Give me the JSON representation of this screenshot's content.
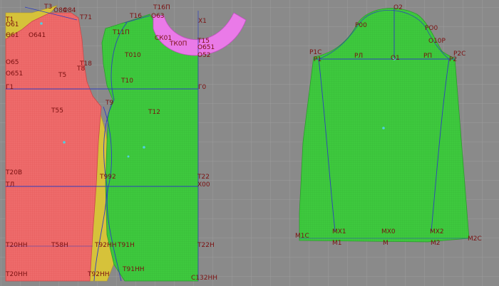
{
  "colors": {
    "background": "#8a8a8a",
    "grid": "#9c9c9c",
    "back_piece": "#ee6b6b",
    "front_piece": "#3ec93e",
    "sleeve_piece": "#3ec93e",
    "yellow_piece": "#d6c23a",
    "facing_piece": "#ea7ae8",
    "line": "#2e3fbf",
    "label": "#7a1010",
    "point": "#4fd0e0"
  },
  "bodice_labels": {
    "t1": "T1",
    "t3": "T3",
    "o84": "О84",
    "o84b": "О84",
    "t71": "Т71",
    "t16": "Т16",
    "t16p": "Т16П",
    "x1": "Х1",
    "o61": "О61",
    "o61b": "Ө61",
    "o641": "О641",
    "t11p": "Т11П",
    "o63": "О63",
    "ck01": "СК01",
    "tkop": "ТК0П",
    "t15": "Т15",
    "o651": "О651",
    "o52": "О52",
    "t18": "Т18",
    "t8": "Т8",
    "o65": "О65",
    "t010": "Т010",
    "o651b": "О651",
    "t5": "Т5",
    "t10": "Т10",
    "g1": "Г1",
    "g0": "Г0",
    "t9": "Т9",
    "t55": "Т55",
    "t12": "Т12",
    "t20b": "Т20В",
    "t92": "Т992",
    "t22": "Т22",
    "tl": "ТЛ",
    "x00": "Х00",
    "t20h": "Т20НН",
    "t58h": "Т58Н",
    "t92h": "Т92НН",
    "t91h": "Т91Н",
    "t22h": "Т22Н",
    "t20hh": "Т20НН",
    "t92hh": "Т92НН",
    "t91hh": "Т91НН",
    "c32hh": "С132НН"
  },
  "sleeve_labels": {
    "o2": "О2",
    "p00": "Р00",
    "po0": "РО0",
    "o10p": "О10Р",
    "p1c": "Р1С",
    "p1": "Р1",
    "pl": "РЛ",
    "o1": "О1",
    "pp": "РП",
    "p2": "Р2",
    "p2c": "Р2С",
    "m1c": "М1С",
    "mx1": "МХ1",
    "mx0": "МХ0",
    "mx2": "МХ2",
    "m2c": "М2С",
    "m1": "М1",
    "m": "М",
    "m2": "М2"
  }
}
